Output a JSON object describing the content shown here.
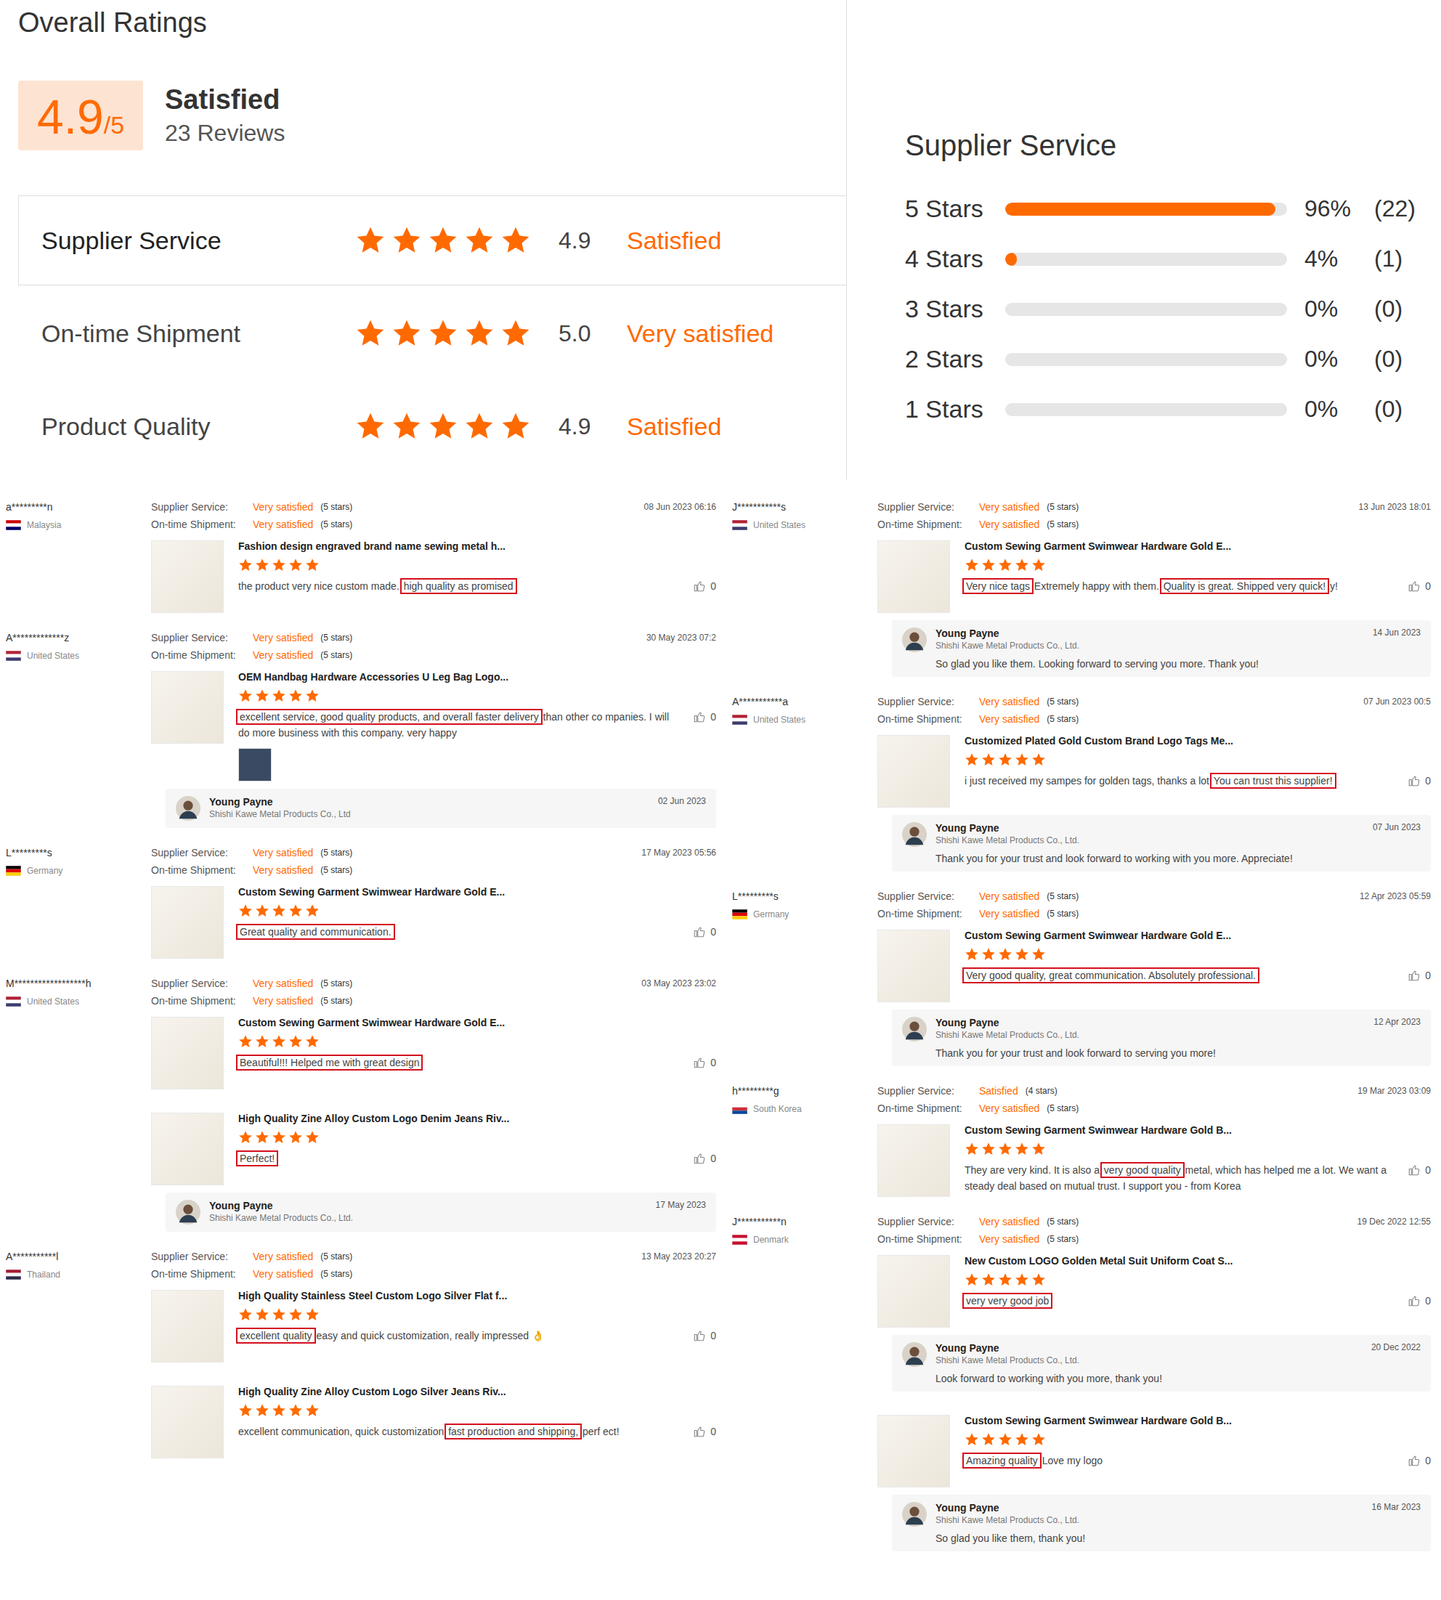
{
  "page": {
    "title": "Overall Ratings"
  },
  "summary": {
    "score": "4.9",
    "outOf": "/5",
    "verdict": "Satisfied",
    "reviewCount": "23 Reviews"
  },
  "ratings": [
    {
      "label": "Supplier Service",
      "stars": 5,
      "score": "4.9",
      "verdict": "Satisfied",
      "selected": true
    },
    {
      "label": "On-time Shipment",
      "stars": 5,
      "score": "5.0",
      "verdict": "Very satisfied",
      "selected": false
    },
    {
      "label": "Product Quality",
      "stars": 5,
      "score": "4.9",
      "verdict": "Satisfied",
      "selected": false
    }
  ],
  "breakdown": {
    "title": "Supplier Service",
    "rows": [
      {
        "label": "5 Stars",
        "level": 0.96,
        "percent": "96%",
        "count": "(22)"
      },
      {
        "label": "4 Stars",
        "level": 0.04,
        "percent": "4%",
        "count": "(1)"
      },
      {
        "label": "3 Stars",
        "level": 0,
        "percent": "0%",
        "count": "(0)"
      },
      {
        "label": "2 Stars",
        "level": 0,
        "percent": "0%",
        "count": "(0)"
      },
      {
        "label": "1 Stars",
        "level": 0,
        "percent": "0%",
        "count": "(0)"
      }
    ]
  },
  "reviews": {
    "columns": [
      [
        {
          "user": "a*********n",
          "country": "Malaysia",
          "flagColors": [
            "#cc0001",
            "#ffffff",
            "#010066"
          ],
          "meta": [
            {
              "label": "Supplier Service:",
              "value": "Very satisfied",
              "detail": "(5 stars)"
            },
            {
              "label": "On-time Shipment:",
              "value": "Very satisfied",
              "detail": "(5 stars)"
            }
          ],
          "date": "08 Jun 2023 06:16",
          "product": "Fashion design engraved brand name sewing metal h...",
          "stars": 5,
          "segments": [
            {
              "text": "the product very nice custom made. ",
              "highlight": false
            },
            {
              "text": "high quality as promised",
              "highlight": true
            }
          ],
          "likes": "0",
          "hasPhoto": false
        },
        {
          "user": "A*************z",
          "country": "United States",
          "flagColors": [
            "#b22234",
            "#ffffff",
            "#3c3b6e"
          ],
          "meta": [
            {
              "label": "Supplier Service:",
              "value": "Very satisfied",
              "detail": "(5 stars)"
            },
            {
              "label": "On-time Shipment:",
              "value": "Very satisfied",
              "detail": "(5 stars)"
            }
          ],
          "date": "30 May 2023 07:2",
          "product": "OEM Handbag Hardware Accessories U Leg Bag Logo...",
          "stars": 5,
          "segments": [
            {
              "text": "excellent service, good quality products, and overall faster delivery",
              "highlight": true
            },
            {
              "text": " than other co mpanies. I will do more business with this company. very happy",
              "highlight": false
            }
          ],
          "likes": "0",
          "hasPhoto": true,
          "reply": {
            "name": "Young Payne",
            "company": "Shishi Kawe Metal Products Co., Ltd",
            "date": "02 Jun 2023"
          }
        },
        {
          "user": "L*********s",
          "country": "Germany",
          "flagColors": [
            "#000000",
            "#dd0000",
            "#ffce00"
          ],
          "meta": [
            {
              "label": "Supplier Service:",
              "value": "Very satisfied",
              "detail": "(5 stars)"
            },
            {
              "label": "On-time Shipment:",
              "value": "Very satisfied",
              "detail": "(5 stars)"
            }
          ],
          "date": "17 May 2023 05:56",
          "product": "Custom Sewing Garment Swimwear Hardware Gold E...",
          "stars": 5,
          "segments": [
            {
              "text": "Great quality and communication.",
              "highlight": true
            }
          ],
          "likes": "0",
          "hasPhoto": false
        },
        {
          "user": "M******************h",
          "country": "United States",
          "flagColors": [
            "#b22234",
            "#ffffff",
            "#3c3b6e"
          ],
          "meta": [
            {
              "label": "Supplier Service:",
              "value": "Very satisfied",
              "detail": "(5 stars)"
            },
            {
              "label": "On-time Shipment:",
              "value": "Very satisfied",
              "detail": "(5 stars)"
            }
          ],
          "date": "03 May 2023 23:02",
          "product": "Custom Sewing Garment Swimwear Hardware Gold E...",
          "stars": 5,
          "segments": [
            {
              "text": "Beautiful!!! Helped me with great design",
              "highlight": true
            }
          ],
          "likes": "0",
          "hasPhoto": false
        },
        {
          "product": "High Quality Zine Alloy Custom Logo Denim Jeans Riv...",
          "stars": 5,
          "segments": [
            {
              "text": "Perfect!",
              "highlight": true
            }
          ],
          "likes": "0",
          "hasPhoto": false,
          "reply": {
            "name": "Young Payne",
            "company": "Shishi Kawe Metal Products Co., Ltd.",
            "date": "17 May 2023"
          }
        },
        {
          "user": "A***********l",
          "country": "Thailand",
          "flagColors": [
            "#a51931",
            "#f4f5f8",
            "#2d2a4a"
          ],
          "meta": [
            {
              "label": "Supplier Service:",
              "value": "Very satisfied",
              "detail": "(5 stars)"
            },
            {
              "label": "On-time Shipment:",
              "value": "Very satisfied",
              "detail": "(5 stars)"
            }
          ],
          "date": "13 May 2023 20:27",
          "product": "High Quality Stainless Steel Custom Logo Silver Flat f...",
          "stars": 5,
          "segments": [
            {
              "text": "excellent quality",
              "highlight": true
            },
            {
              "text": " easy and quick customization, really impressed 👌",
              "highlight": false
            }
          ],
          "likes": "0",
          "hasPhoto": false
        },
        {
          "product": "High Quality Zine Alloy Custom Logo Silver Jeans Riv...",
          "stars": 5,
          "segments": [
            {
              "text": "excellent communication, quick customization ",
              "highlight": false
            },
            {
              "text": "fast production and shipping,",
              "highlight": true
            },
            {
              "text": " perf ect!",
              "highlight": false
            }
          ],
          "likes": "0",
          "hasPhoto": false
        }
      ],
      [
        {
          "user": "J***********s",
          "country": "United States",
          "flagColors": [
            "#b22234",
            "#ffffff",
            "#3c3b6e"
          ],
          "meta": [
            {
              "label": "Supplier Service:",
              "value": "Very satisfied",
              "detail": "(5 stars)"
            },
            {
              "label": "On-time Shipment:",
              "value": "Very satisfied",
              "detail": "(5 stars)"
            }
          ],
          "date": "13 Jun 2023 18:01",
          "product": "Custom Sewing Garment Swimwear Hardware Gold E...",
          "stars": 5,
          "segments": [
            {
              "text": "Very nice tags",
              "highlight": true
            },
            {
              "text": " Extremely happy with them. ",
              "highlight": false
            },
            {
              "text": "Quality is great.  Shipped very quick!",
              "highlight": true
            },
            {
              "text": " y!",
              "highlight": false
            }
          ],
          "likes": "0",
          "hasPhoto": false,
          "reply": {
            "name": "Young Payne",
            "company": "Shishi Kawe Metal Products Co., Ltd.",
            "date": "14 Jun 2023",
            "message": "So glad you like them. Looking forward to serving you more. Thank you!"
          }
        },
        {
          "user": "A***********a",
          "country": "United States",
          "flagColors": [
            "#b22234",
            "#ffffff",
            "#3c3b6e"
          ],
          "meta": [
            {
              "label": "Supplier Service:",
              "value": "Very satisfied",
              "detail": "(5 stars)"
            },
            {
              "label": "On-time Shipment:",
              "value": "Very satisfied",
              "detail": "(5 stars)"
            }
          ],
          "date": "07 Jun 2023 00:5",
          "product": "Customized Plated Gold Custom Brand Logo Tags Me...",
          "stars": 5,
          "segments": [
            {
              "text": "i just received my sampes for golden tags, thanks a lot ",
              "highlight": false
            },
            {
              "text": "You can trust this supplier!",
              "highlight": true
            }
          ],
          "likes": "0",
          "hasPhoto": false,
          "reply": {
            "name": "Young Payne",
            "company": "Shishi Kawe Metal Products Co., Ltd.",
            "date": "07 Jun 2023",
            "message": "Thank you for your trust and look forward to working with you more. Appreciate!"
          }
        },
        {
          "user": "L*********s",
          "country": "Germany",
          "flagColors": [
            "#000000",
            "#dd0000",
            "#ffce00"
          ],
          "meta": [
            {
              "label": "Supplier Service:",
              "value": "Very satisfied",
              "detail": "(5 stars)"
            },
            {
              "label": "On-time Shipment:",
              "value": "Very satisfied",
              "detail": "(5 stars)"
            }
          ],
          "date": "12 Apr 2023 05:59",
          "product": "Custom Sewing Garment Swimwear Hardware Gold E...",
          "stars": 5,
          "segments": [
            {
              "text": "Very good quality, great communication. Absolutely professional.",
              "highlight": true
            }
          ],
          "likes": "0",
          "hasPhoto": false,
          "reply": {
            "name": "Young Payne",
            "company": "Shishi Kawe Metal Products Co., Ltd.",
            "date": "12 Apr 2023",
            "message": "Thank you for your trust and look forward to serving you more!"
          }
        },
        {
          "user": "h*********g",
          "country": "South Korea",
          "flagColors": [
            "#ffffff",
            "#cd2e3a",
            "#0047a0"
          ],
          "meta": [
            {
              "label": "Supplier Service:",
              "value": "Satisfied",
              "detail": "(4 stars)"
            },
            {
              "label": "On-time Shipment:",
              "value": "Very satisfied",
              "detail": "(5 stars)"
            }
          ],
          "date": "19 Mar 2023 03:09",
          "product": "Custom Sewing Garment Swimwear Hardware Gold B...",
          "stars": 5,
          "segments": [
            {
              "text": "They are very kind. It is also a ",
              "highlight": false
            },
            {
              "text": "very good quality",
              "highlight": true
            },
            {
              "text": " metal, which has helped me a lot. We want a steady deal based on mutual trust. I support you - from Korea",
              "highlight": false
            }
          ],
          "likes": "0",
          "hasPhoto": false
        },
        {
          "user": "J***********n",
          "country": "Denmark",
          "flagColors": [
            "#c8102e",
            "#ffffff",
            "#c8102e"
          ],
          "meta": [
            {
              "label": "Supplier Service:",
              "value": "Very satisfied",
              "detail": "(5 stars)"
            },
            {
              "label": "On-time Shipment:",
              "value": "Very satisfied",
              "detail": "(5 stars)"
            }
          ],
          "date": "19 Dec 2022 12:55",
          "product": "New Custom LOGO Golden Metal Suit Uniform Coat S...",
          "stars": 5,
          "segments": [
            {
              "text": "very very good job",
              "highlight": true
            }
          ],
          "likes": "0",
          "hasPhoto": false,
          "reply": {
            "name": "Young Payne",
            "company": "Shishi Kawe Metal Products Co., Ltd.",
            "date": "20 Dec 2022",
            "message": "Look forward to working with you more, thank you!"
          }
        },
        {
          "product": "Custom Sewing Garment Swimwear Hardware Gold B...",
          "stars": 5,
          "segments": [
            {
              "text": "Amazing quality",
              "highlight": true
            },
            {
              "text": " Love my logo",
              "highlight": false
            }
          ],
          "likes": "0",
          "hasPhoto": false,
          "reply": {
            "name": "Young Payne",
            "company": "Shishi Kawe Metal Products Co., Ltd.",
            "date": "16 Mar 2023",
            "message": "So glad you like them, thank you!"
          }
        }
      ]
    ]
  }
}
